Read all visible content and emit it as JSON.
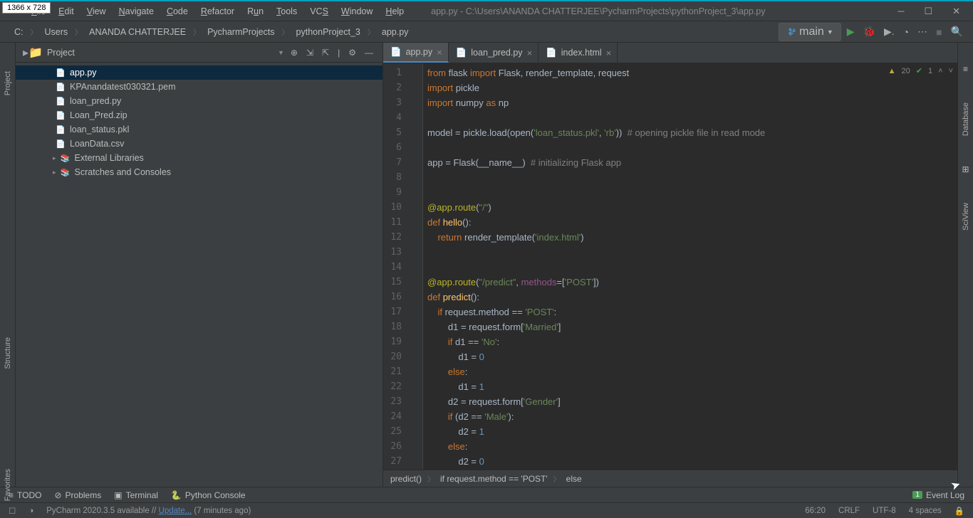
{
  "tooltip": "1366 x 728",
  "menus": [
    "File",
    "Edit",
    "View",
    "Navigate",
    "Code",
    "Refactor",
    "Run",
    "Tools",
    "VCS",
    "Window",
    "Help"
  ],
  "window_title": "app.py - C:\\Users\\ANANDA CHATTERJEE\\PycharmProjects\\pythonProject_3\\app.py",
  "breadcrumb": [
    "C:",
    "Users",
    "ANANDA CHATTERJEE",
    "PycharmProjects",
    "pythonProject_3",
    "app.py"
  ],
  "run_config": "main",
  "project_panel_title": "Project",
  "tree_items": [
    {
      "label": "app.py",
      "icon": "py",
      "sel": true
    },
    {
      "label": "KPAnandatest030321.pem",
      "icon": "file"
    },
    {
      "label": "loan_pred.py",
      "icon": "py"
    },
    {
      "label": "Loan_Pred.zip",
      "icon": "zip"
    },
    {
      "label": "loan_status.pkl",
      "icon": "file"
    },
    {
      "label": "LoanData.csv",
      "icon": "file"
    }
  ],
  "tree_roots": [
    {
      "label": "External Libraries",
      "icon": "libs"
    },
    {
      "label": "Scratches and Consoles",
      "icon": "scratch"
    }
  ],
  "tabs": [
    {
      "label": "app.py",
      "active": true
    },
    {
      "label": "loan_pred.py",
      "active": false
    },
    {
      "label": "index.html",
      "active": false
    }
  ],
  "code_lines": [
    {
      "n": 1,
      "segs": [
        [
          "kw",
          "from"
        ],
        [
          "",
          " flask "
        ],
        [
          "kw",
          "import"
        ],
        [
          "",
          " Flask, render_template, request"
        ]
      ]
    },
    {
      "n": 2,
      "segs": [
        [
          "kw",
          "import"
        ],
        [
          "",
          " pickle"
        ]
      ]
    },
    {
      "n": 3,
      "segs": [
        [
          "kw",
          "import"
        ],
        [
          "",
          " numpy "
        ],
        [
          "kw",
          "as"
        ],
        [
          "",
          " np"
        ]
      ]
    },
    {
      "n": 4,
      "segs": [
        [
          "",
          ""
        ]
      ]
    },
    {
      "n": 5,
      "segs": [
        [
          "",
          "model = pickle.load(open("
        ],
        [
          "str",
          "'loan_status.pkl'"
        ],
        [
          "",
          ", "
        ],
        [
          "str",
          "'rb'"
        ],
        [
          "",
          "))  "
        ],
        [
          "com",
          "# opening pickle file in read mode"
        ]
      ]
    },
    {
      "n": 6,
      "segs": [
        [
          "",
          ""
        ]
      ]
    },
    {
      "n": 7,
      "segs": [
        [
          "",
          "app = Flask(__name__)  "
        ],
        [
          "com",
          "# initializing Flask app"
        ]
      ]
    },
    {
      "n": 8,
      "segs": [
        [
          "",
          ""
        ]
      ]
    },
    {
      "n": 9,
      "segs": [
        [
          "",
          ""
        ]
      ]
    },
    {
      "n": 10,
      "segs": [
        [
          "dec",
          "@app.route"
        ],
        [
          "",
          "("
        ],
        [
          "str",
          "\"/\""
        ],
        [
          "",
          ")"
        ]
      ]
    },
    {
      "n": 11,
      "segs": [
        [
          "kw",
          "def "
        ],
        [
          "fn",
          "hello"
        ],
        [
          "",
          "():"
        ]
      ]
    },
    {
      "n": 12,
      "segs": [
        [
          "",
          "    "
        ],
        [
          "kw",
          "return"
        ],
        [
          "",
          " render_template("
        ],
        [
          "str",
          "'index.html'"
        ],
        [
          "",
          ")"
        ]
      ]
    },
    {
      "n": 13,
      "segs": [
        [
          "",
          ""
        ]
      ]
    },
    {
      "n": 14,
      "segs": [
        [
          "",
          ""
        ]
      ]
    },
    {
      "n": 15,
      "segs": [
        [
          "dec",
          "@app.route"
        ],
        [
          "",
          "("
        ],
        [
          "str",
          "\"/predict\""
        ],
        [
          "",
          ", "
        ],
        [
          "self",
          "methods"
        ],
        [
          "",
          "=["
        ],
        [
          "str",
          "'POST'"
        ],
        [
          "",
          "])"
        ]
      ]
    },
    {
      "n": 16,
      "segs": [
        [
          "kw",
          "def "
        ],
        [
          "fn",
          "predict"
        ],
        [
          "",
          "():"
        ]
      ]
    },
    {
      "n": 17,
      "segs": [
        [
          "",
          "    "
        ],
        [
          "kw",
          "if"
        ],
        [
          "",
          " request.method == "
        ],
        [
          "str",
          "'POST'"
        ],
        [
          "",
          ":"
        ]
      ]
    },
    {
      "n": 18,
      "segs": [
        [
          "",
          "        d1 = request.form["
        ],
        [
          "str",
          "'Married'"
        ],
        [
          "",
          "]"
        ]
      ]
    },
    {
      "n": 19,
      "segs": [
        [
          "",
          "        "
        ],
        [
          "kw",
          "if"
        ],
        [
          "",
          " d1 == "
        ],
        [
          "str",
          "'No'"
        ],
        [
          "",
          ":"
        ]
      ]
    },
    {
      "n": 20,
      "segs": [
        [
          "",
          "            d1 = "
        ],
        [
          "num",
          "0"
        ]
      ]
    },
    {
      "n": 21,
      "segs": [
        [
          "",
          "        "
        ],
        [
          "kw",
          "else"
        ],
        [
          "",
          ":"
        ]
      ]
    },
    {
      "n": 22,
      "segs": [
        [
          "",
          "            d1 = "
        ],
        [
          "num",
          "1"
        ]
      ]
    },
    {
      "n": 23,
      "segs": [
        [
          "",
          "        d2 = request.form["
        ],
        [
          "str",
          "'Gender'"
        ],
        [
          "",
          "]"
        ]
      ]
    },
    {
      "n": 24,
      "segs": [
        [
          "",
          "        "
        ],
        [
          "kw",
          "if"
        ],
        [
          "",
          " (d2 == "
        ],
        [
          "str",
          "'Male'"
        ],
        [
          "",
          "):"
        ]
      ]
    },
    {
      "n": 25,
      "segs": [
        [
          "",
          "            d2 = "
        ],
        [
          "num",
          "1"
        ]
      ]
    },
    {
      "n": 26,
      "segs": [
        [
          "",
          "        "
        ],
        [
          "kw",
          "else"
        ],
        [
          "",
          ":"
        ]
      ]
    },
    {
      "n": 27,
      "segs": [
        [
          "",
          "            d2 = "
        ],
        [
          "num",
          "0"
        ]
      ]
    }
  ],
  "inspect_warn": "20",
  "inspect_ok": "1",
  "code_crumb": [
    "predict()",
    "if request.method == 'POST'",
    "else"
  ],
  "tool_window": [
    "TODO",
    "Problems",
    "Terminal",
    "Python Console"
  ],
  "event_log": "Event Log",
  "event_count": "1",
  "status_update": "PyCharm 2020.3.5 available //",
  "status_update_link": "Update...",
  "status_update_time": "(7 minutes ago)",
  "status_right": [
    "66:20",
    "CRLF",
    "UTF-8",
    "4 spaces"
  ],
  "left_gutter": [
    "Project",
    "Structure",
    "Favorites"
  ],
  "right_gutter": [
    "Database",
    "SciView"
  ]
}
